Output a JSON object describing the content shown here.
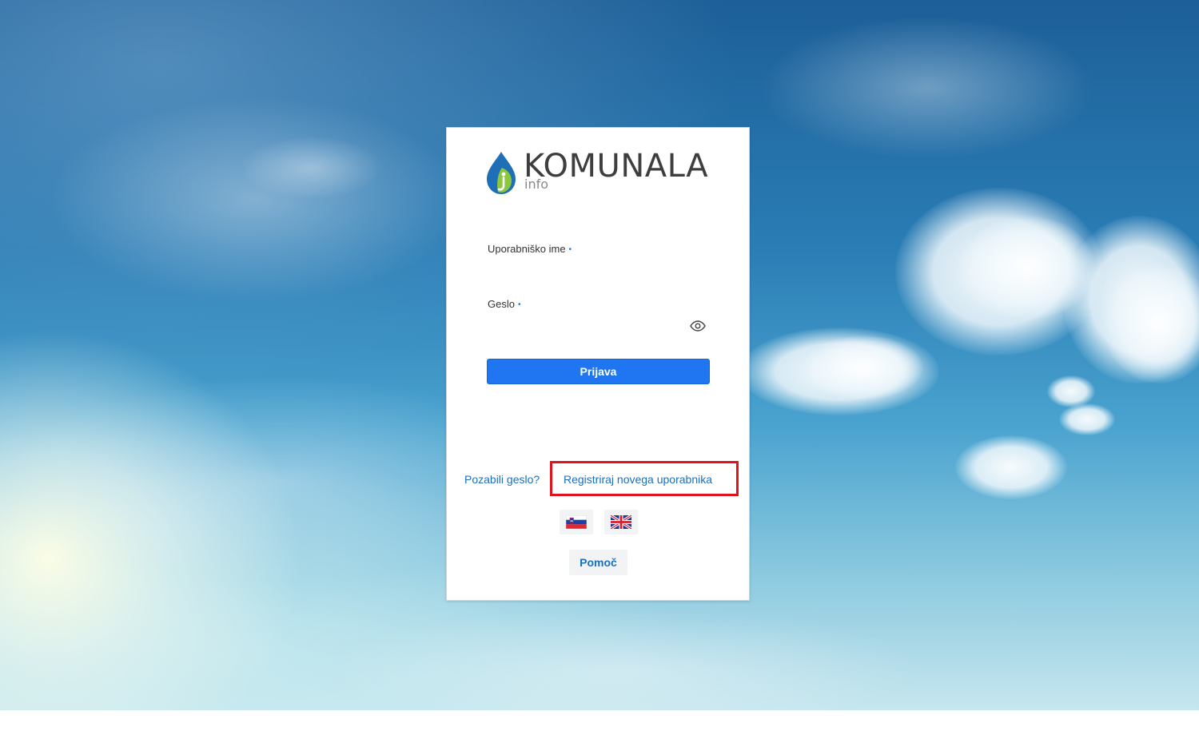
{
  "brand": {
    "name": "KOMUNALA",
    "sub": "info",
    "colors": {
      "drop_blue": "#1f6fb8",
      "leaf_green": "#8dc63f",
      "text_dark": "#3e3e3e"
    }
  },
  "form": {
    "username_label": "Uporabniško ime",
    "username_required_mark": "•",
    "username_value": "",
    "password_label": "Geslo",
    "password_required_mark": "•",
    "password_value": "",
    "toggle_icon": "eye-icon",
    "login_label": "Prijava"
  },
  "links": {
    "forgot_password": "Pozabili geslo?",
    "register": "Registriraj novega uporabnika"
  },
  "languages": [
    {
      "code": "sl",
      "icon": "slovenia-flag-icon"
    },
    {
      "code": "en",
      "icon": "uk-flag-icon"
    }
  ],
  "help_label": "Pomoč",
  "colors": {
    "primary": "#1f76f0",
    "link": "#1a6fbe",
    "highlight_border": "#e0121b"
  }
}
